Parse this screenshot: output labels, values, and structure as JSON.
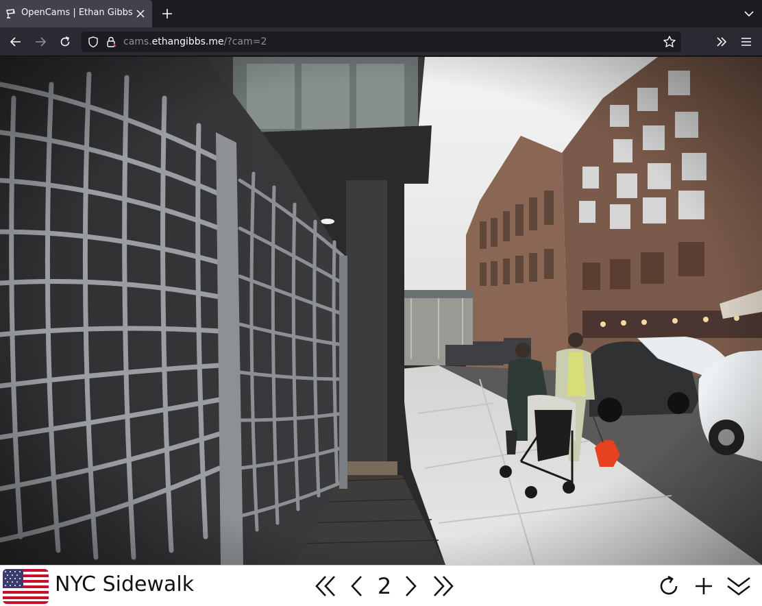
{
  "browser": {
    "tab": {
      "title": "OpenCams | Ethan Gibbs",
      "favicon": "camera-icon",
      "close": "close-icon"
    },
    "new_tab": "plus-icon",
    "tab_list": "chevron-down-icon",
    "nav": {
      "back": "arrow-left-icon",
      "forward": "arrow-right-icon",
      "reload": "reload-icon"
    },
    "url": {
      "prefix": "cams.",
      "host": "ethangibbs.me",
      "path": "/?cam=2",
      "shield": "shield-icon",
      "lock": "lock-icon",
      "bookmark": "star-icon"
    },
    "overflow": "double-chevron-right-icon",
    "menu": "hamburger-menu-icon"
  },
  "camera": {
    "flag": "us-flag-icon",
    "name": "NYC Sidewalk",
    "number": "2",
    "controls": {
      "first": "double-chevron-left-icon",
      "prev": "chevron-left-icon",
      "next": "chevron-right-icon",
      "last": "double-chevron-right-icon",
      "refresh": "refresh-icon",
      "add": "plus-icon",
      "expand": "double-chevron-down-icon"
    }
  },
  "colors": {
    "chrome_dark": "#1c1b22",
    "chrome_toolbar": "#2b2a33",
    "tab_active": "#42414d",
    "controls_bg": "#ffffff"
  }
}
